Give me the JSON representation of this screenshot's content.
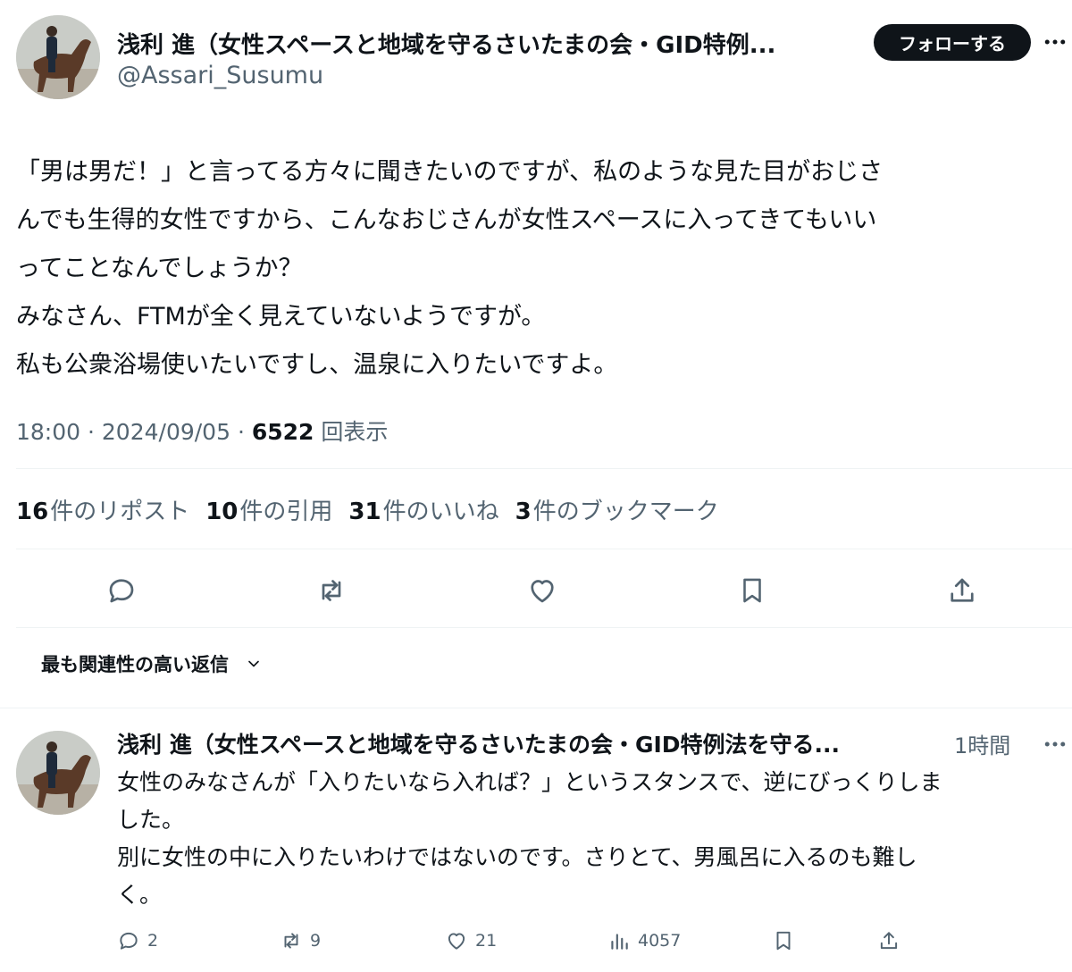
{
  "tweet": {
    "author_name": "浅利 進（女性スペースと地域を守るさいたまの会・GID特例...",
    "author_handle": "@Assari_Susumu",
    "follow_label": "フォローする",
    "body_lines": [
      "「男は男だ！」と言ってる方々に聞きたいのですが、私のような見た目がおじさ",
      "んでも生得的女性ですから、こんなおじさんが女性スペースに入ってきてもいい",
      "ってことなんでしょうか？",
      "みなさん、FTMが全く見えていないようですが。",
      "私も公衆浴場使いたいですし、温泉に入りたいですよ。"
    ],
    "time": "18:00",
    "date": "2024/09/05",
    "views": "6522",
    "views_label": "回表示",
    "stats": [
      {
        "count": "16",
        "label": "件のリポスト"
      },
      {
        "count": "10",
        "label": "件の引用"
      },
      {
        "count": "31",
        "label": "件のいいね"
      },
      {
        "count": "3",
        "label": "件のブックマーク"
      }
    ],
    "actions": [
      "reply-icon",
      "retweet-icon",
      "like-icon",
      "bookmark-icon",
      "share-icon"
    ]
  },
  "sort": {
    "label": "最も関連性の高い返信"
  },
  "reply": {
    "author_name": "浅利 進（女性スペースと地域を守るさいたまの会・GID特例法を守る...",
    "time": "1時間",
    "body_lines": [
      "女性のみなさんが「入りたいなら入れば？」というスタンスで、逆にびっくりしま",
      "した。",
      "別に女性の中に入りたいわけではないのです。さりとて、男風呂に入るのも難し",
      "く。"
    ],
    "reply_count": "2",
    "retweet_count": "9",
    "like_count": "21",
    "view_count": "4057"
  },
  "colors": {
    "text": "#0f1419",
    "secondary": "#536471",
    "divider": "#eff3f4",
    "button_bg": "#0f1419"
  }
}
